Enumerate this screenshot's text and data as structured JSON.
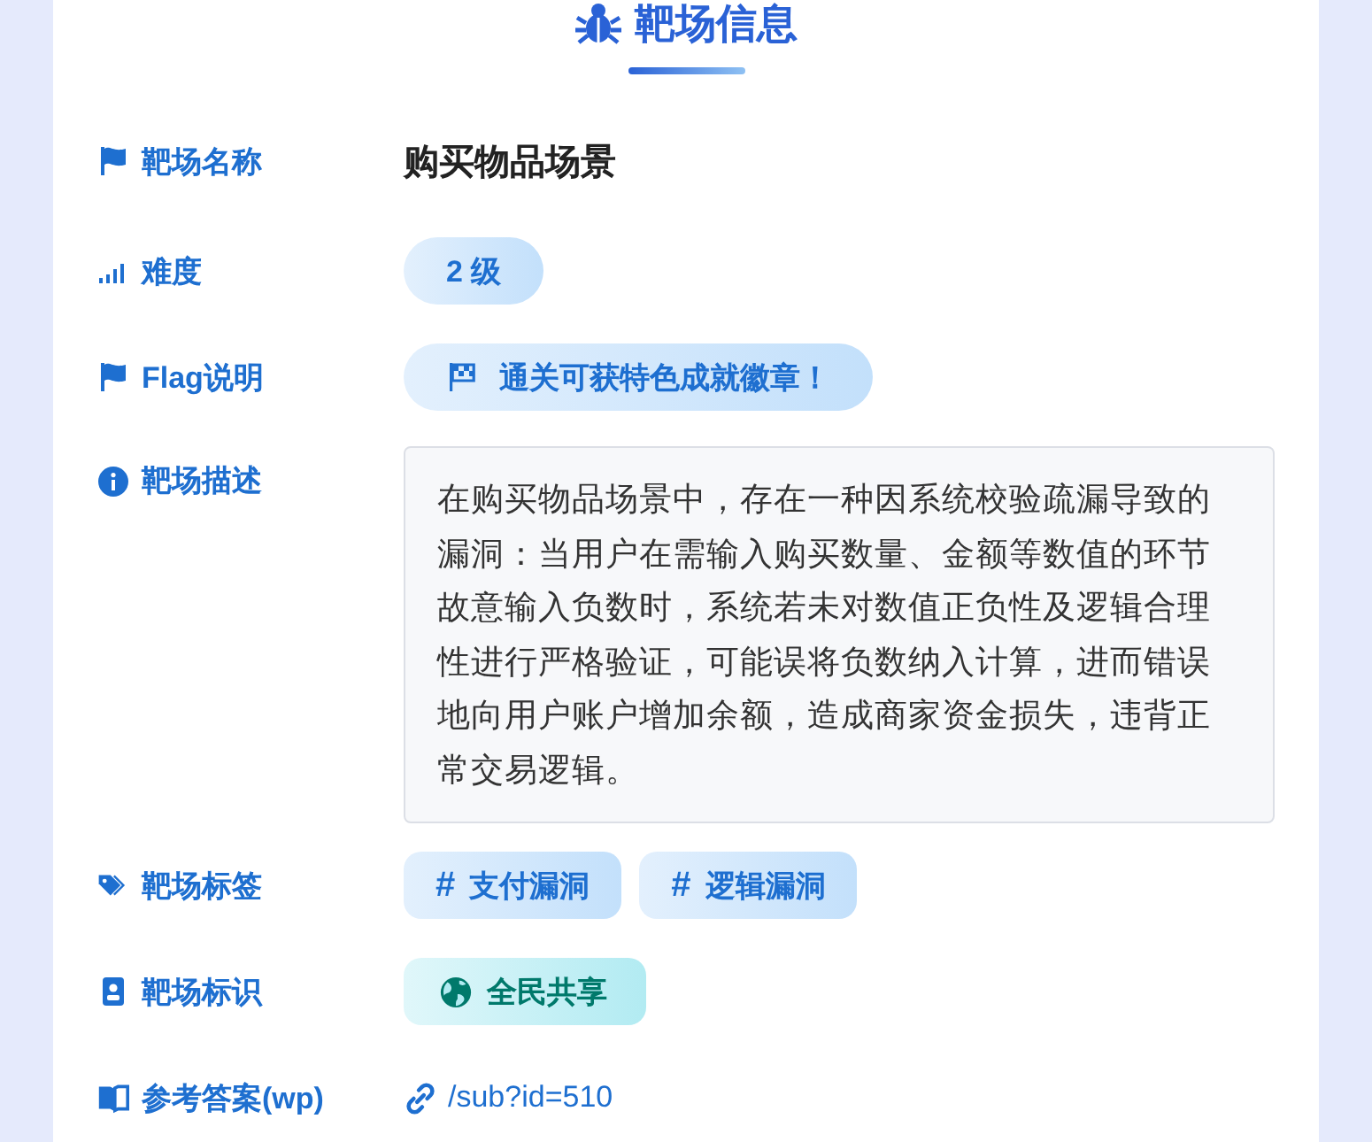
{
  "title": "靶场信息",
  "rows": [
    {
      "kind": "name",
      "label": "靶场名称",
      "value": "购买物品场景"
    },
    {
      "kind": "level",
      "label": "难度",
      "value": "2 级"
    },
    {
      "kind": "flag",
      "label": "Flag说明",
      "value": "通关可获特色成就徽章！"
    },
    {
      "kind": "description",
      "label": "靶场描述",
      "value": "在购买物品场景中，存在一种因系统校验疏漏导致的漏洞：当用户在需输入购买数量、金额等数值的环节故意输入负数时，系统若未对数值正负性及逻辑合理性进行严格验证，可能误将负数纳入计算，进而错误地向用户账户增加余额，造成商家资金损失，违背正常交易逻辑。"
    },
    {
      "kind": "tags",
      "label": "靶场标签",
      "tags": [
        {
          "mark": "#",
          "text": "支付漏洞"
        },
        {
          "mark": "#",
          "text": "逻辑漏洞"
        }
      ]
    },
    {
      "kind": "identity",
      "label": "靶场标识",
      "value": "全民共享"
    },
    {
      "kind": "answer",
      "label": "参考答案(wp)",
      "value": "/sub?id=510"
    }
  ]
}
